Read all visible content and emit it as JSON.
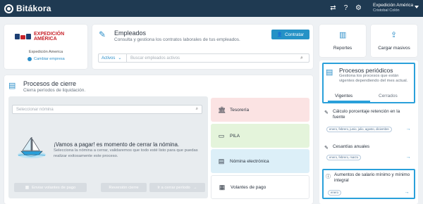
{
  "app": {
    "name": "Bitákora"
  },
  "topbar": {
    "icons": [
      "shuffle-icon",
      "help-icon",
      "gear-icon"
    ],
    "company": "Expedición América",
    "user": "Cristobal Colón"
  },
  "company_card": {
    "logo_line1": "EXPEDICIÓN",
    "logo_line2": "AMÉRICA",
    "name": "Expedición America",
    "change_label": "Cambiar empresa"
  },
  "employees": {
    "title": "Empleados",
    "subtitle": "Consulta y gestiona los contratos laborales de tus empleados.",
    "hire_label": "Contratar",
    "status_filter": "Activos",
    "search_placeholder": "Buscar empleados activos"
  },
  "closing": {
    "title": "Procesos de cierre",
    "subtitle": "Cierra períodos de liquidación.",
    "payroll_placeholder": "Seleccionar nómina",
    "message_title": "¡Vamos a pagar! es momento de cerrar la nómina.",
    "message_body": "Selecciona la nómina a cerrar, validaremos que todo esté listo para que puedas realizar exitosamente este proceso.",
    "buttons": {
      "send_vouchers": "Enviar volantes de pago",
      "reversion": "Reversión cierre",
      "close_period": "Ir a cerrar período"
    },
    "modules": {
      "treasury": "Tesorería",
      "pila": "PILA",
      "e_payroll": "Nómina electrónica",
      "pay_stubs": "Volantes de pago"
    }
  },
  "quick_actions": {
    "reports": "Reportes",
    "bulk_upload": "Cargar masivos"
  },
  "periodic": {
    "title": "Procesos periódicos",
    "subtitle": "Gestiona los procesos que están vigentes dependiendo del mes actual.",
    "tabs": [
      "Vigentes",
      "Cerrados"
    ],
    "active_tab": "Vigentes",
    "items": [
      {
        "title": "Cálculo porcentaje retención en la fuente",
        "months": "enero, febrero, junio, julio, agosto, diciembre"
      },
      {
        "title": "Cesantías anuales",
        "months": "enero, febrero, marzo"
      },
      {
        "title": "Aumentos de salario mínimo y mínimo integral",
        "months": "enero"
      }
    ]
  },
  "colors": {
    "topbar": "#1f3a52",
    "accent": "#2592c6",
    "highlight_border": "#2aa0da",
    "treasury_bg": "#fbe3e3",
    "pila_bg": "#e4f4db",
    "e_payroll_bg": "#dceff8"
  }
}
